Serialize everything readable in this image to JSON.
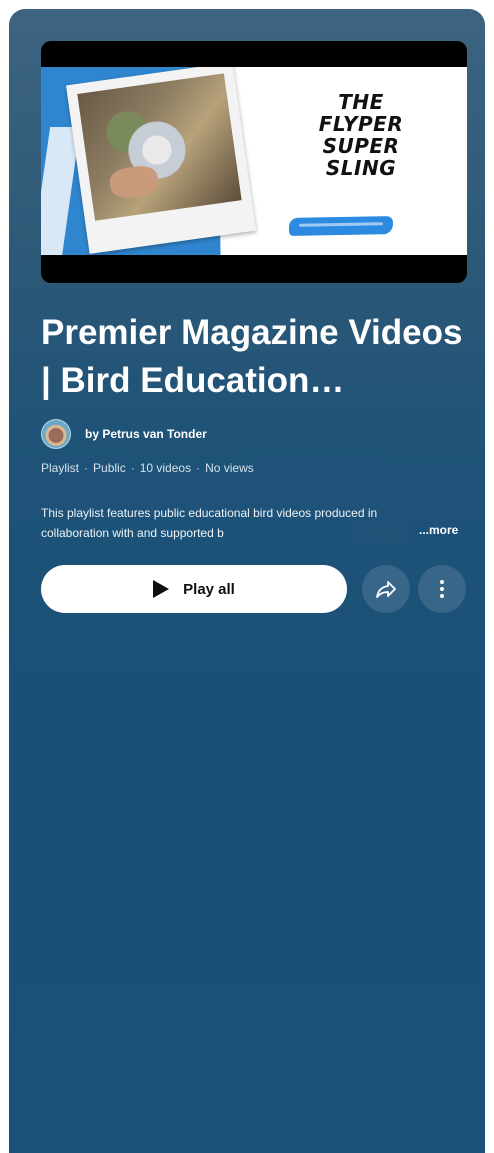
{
  "thumbnail": {
    "title_text": "THE\nFLYPER\nSUPER\nSLING"
  },
  "playlist": {
    "title": "Premier Magazine Videos | Bird Education…",
    "owner": "by Petrus van Tonder",
    "meta": {
      "type": "Playlist",
      "visibility": "Public",
      "video_count": "10 videos",
      "views": "No views",
      "separator": "·"
    },
    "description": "This playlist features public educational bird videos produced in collaboration with and supported b",
    "more_label": "...more"
  },
  "actions": {
    "play_all_label": "Play all"
  },
  "colors": {
    "panel_top": "#3d6480",
    "panel_bottom": "#1b5179",
    "play_button_bg": "#ffffff"
  },
  "icons": {
    "play": "play-icon",
    "share": "share-icon",
    "more": "more-vert-icon"
  }
}
